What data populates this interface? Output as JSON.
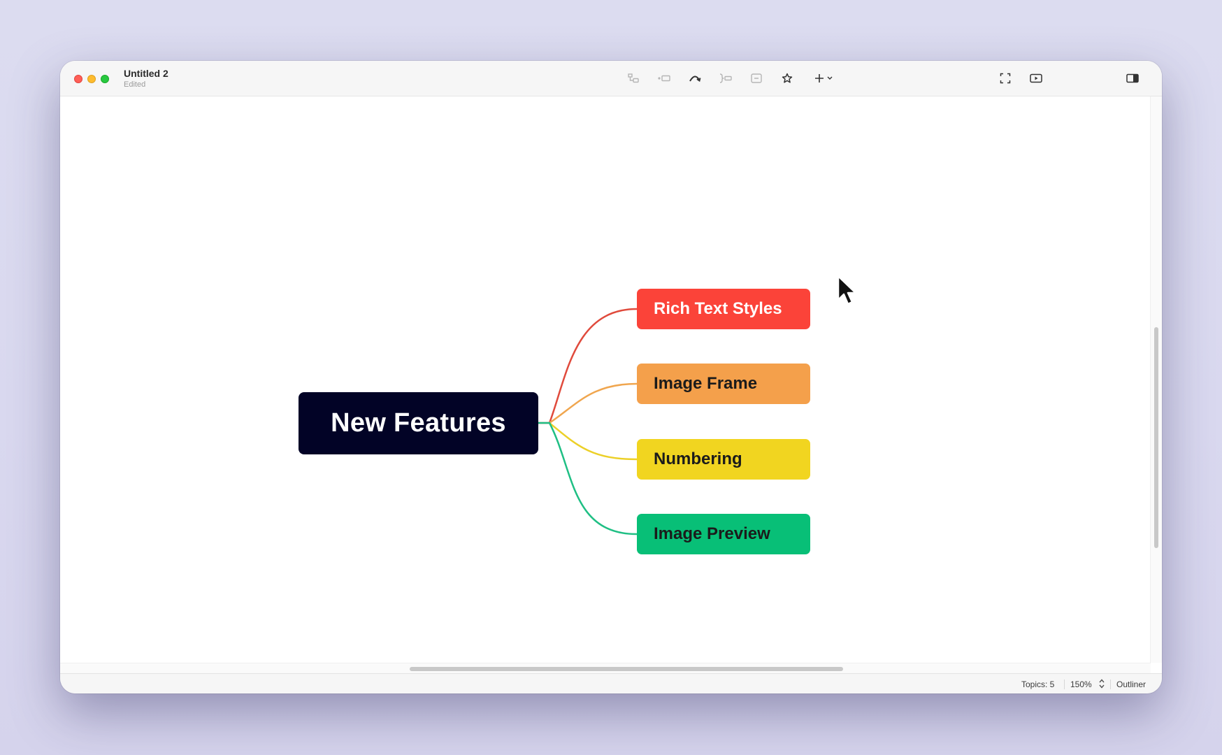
{
  "window": {
    "title": "Untitled 2",
    "subtitle": "Edited"
  },
  "toolbar": {
    "icons": [
      "subtopic-icon",
      "topic-icon",
      "relationship-icon",
      "summary-icon",
      "boundary-icon",
      "marker-icon",
      "insert-icon",
      "zen-mode-icon",
      "pitch-icon",
      "format-panel-icon"
    ]
  },
  "mindmap": {
    "central_topic": "New Features",
    "topics": [
      {
        "label": "Rich Text Styles",
        "color": "#fb4339",
        "text_color": "#ffffff",
        "line_color": "#e04a3c"
      },
      {
        "label": "Image Frame",
        "color": "#f4a04b",
        "text_color": "#1b1b1b",
        "line_color": "#f0a64f"
      },
      {
        "label": "Numbering",
        "color": "#f1d520",
        "text_color": "#1b1b1b",
        "line_color": "#ecd028"
      },
      {
        "label": "Image Preview",
        "color": "#08bf77",
        "text_color": "#1b1b1b",
        "line_color": "#1fbf84"
      }
    ]
  },
  "statusbar": {
    "topics": "Topics: 5",
    "zoom": "150%",
    "outliner": "Outliner"
  }
}
